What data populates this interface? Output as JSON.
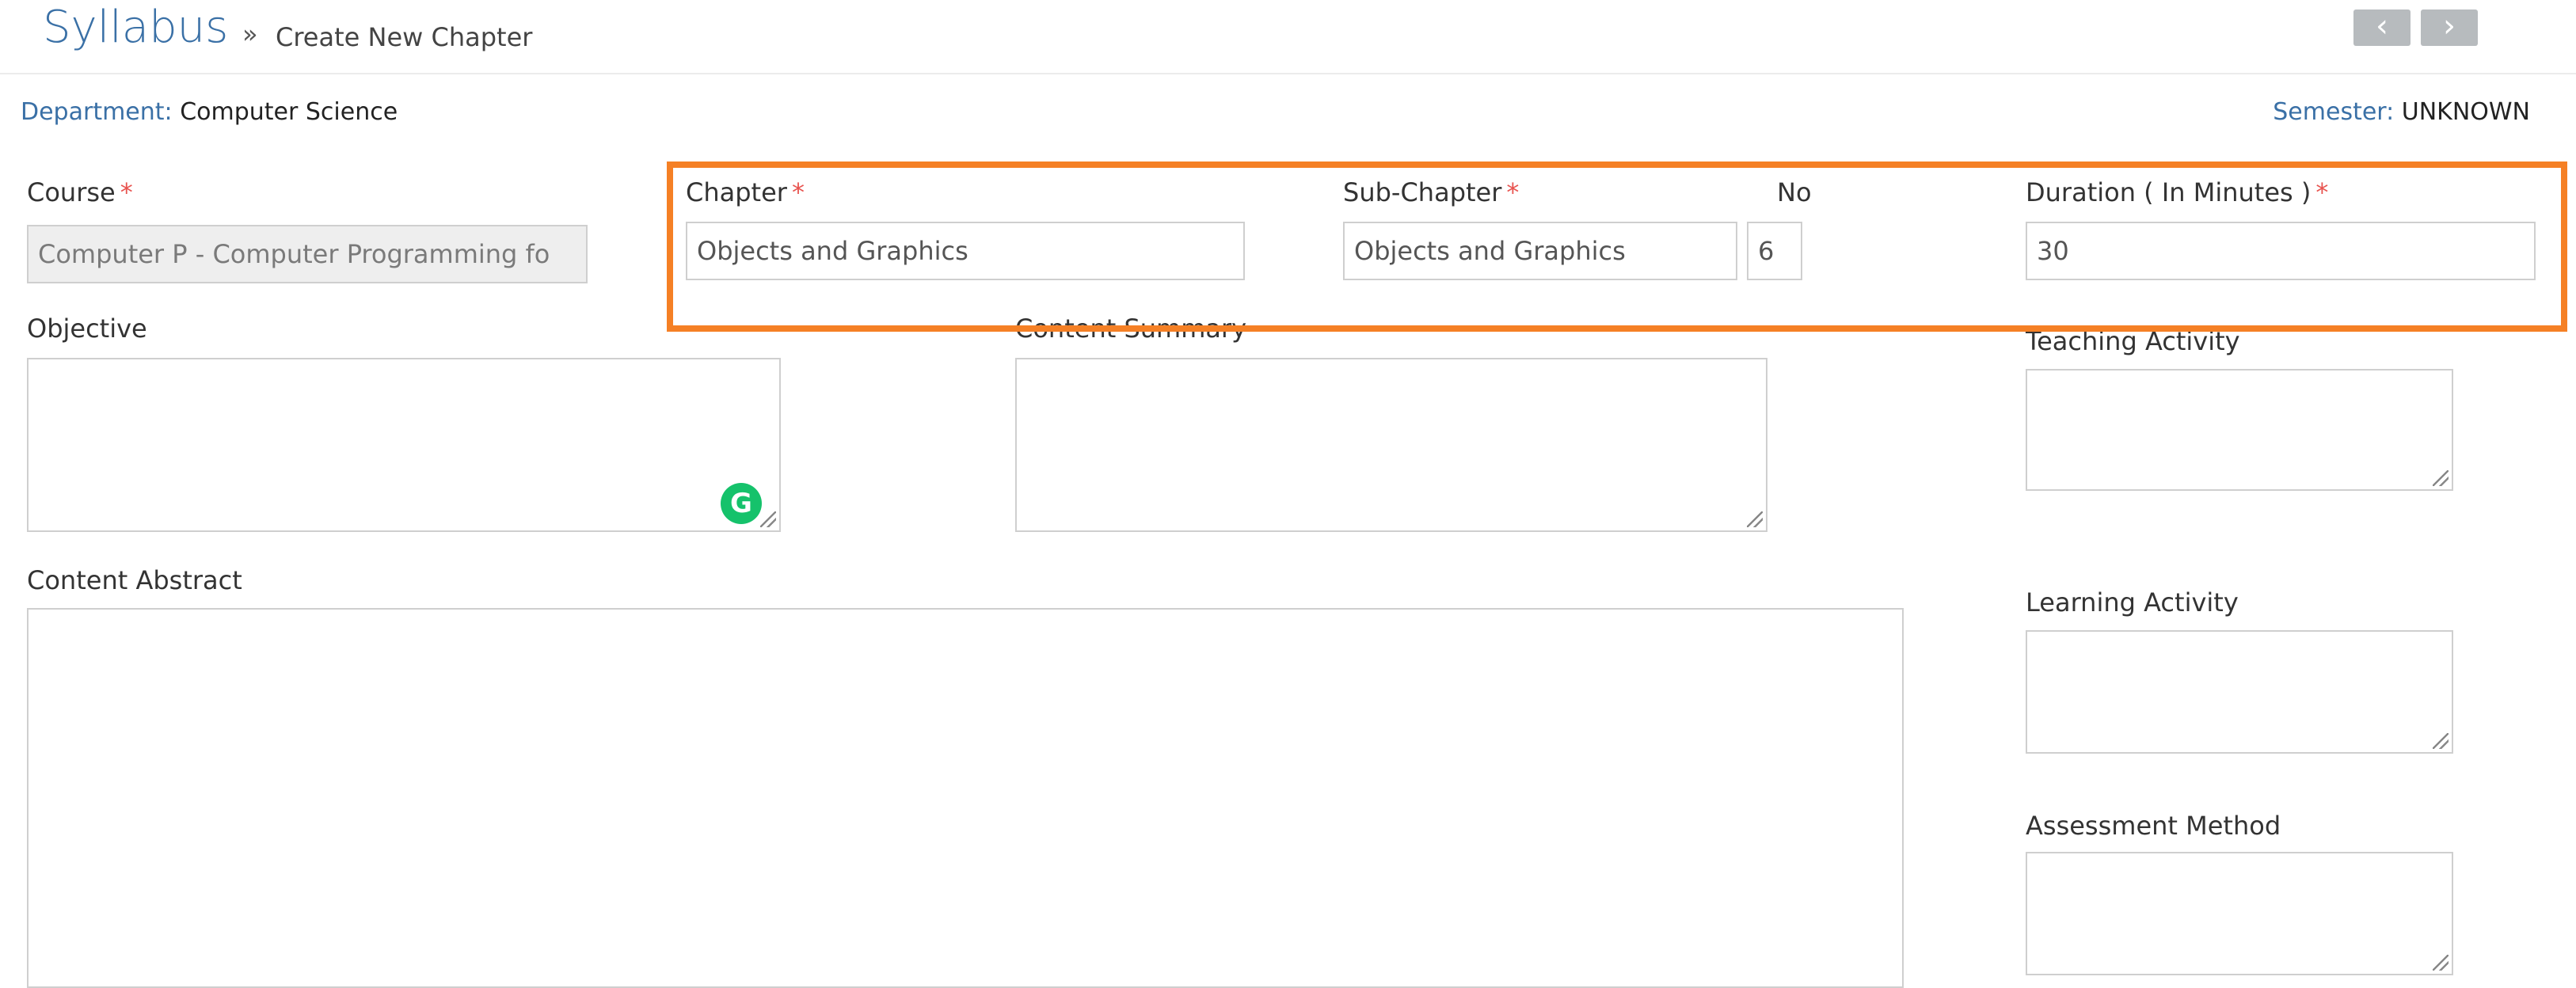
{
  "header": {
    "title": "Syllabus",
    "separator": "»",
    "breadcrumb": "Create New Chapter",
    "prev_icon": "chevron-left-icon",
    "next_icon": "chevron-right-icon",
    "prev_glyph": "‹",
    "next_glyph": "›"
  },
  "meta": {
    "department_label": "Department:",
    "department_value": "Computer Science",
    "semester_label": "Semester:",
    "semester_value": "UNKNOWN"
  },
  "form": {
    "course": {
      "label": "Course",
      "required": "*",
      "value": "Computer P - Computer Programming fo"
    },
    "chapter": {
      "label": "Chapter",
      "required": "*",
      "value": "Objects and Graphics"
    },
    "sub_chapter": {
      "label": "Sub-Chapter",
      "required": "*",
      "value": "Objects and Graphics"
    },
    "no": {
      "label": "No",
      "value": "6"
    },
    "duration": {
      "label": "Duration ( In Minutes )",
      "required": "*",
      "value": "30"
    },
    "objective": {
      "label": "Objective"
    },
    "content_summary": {
      "label": "Content Summary"
    },
    "teaching_activity": {
      "label": "Teaching Activity"
    },
    "content_abstract": {
      "label": "Content Abstract"
    },
    "learning_activity": {
      "label": "Learning Activity"
    },
    "assessment_method": {
      "label": "Assessment Method"
    }
  },
  "grammarly": {
    "icon": "grammarly-icon",
    "glyph": "G"
  },
  "colors": {
    "accent": "#3a70a6",
    "highlight": "#f58025",
    "required": "#e8534f"
  }
}
